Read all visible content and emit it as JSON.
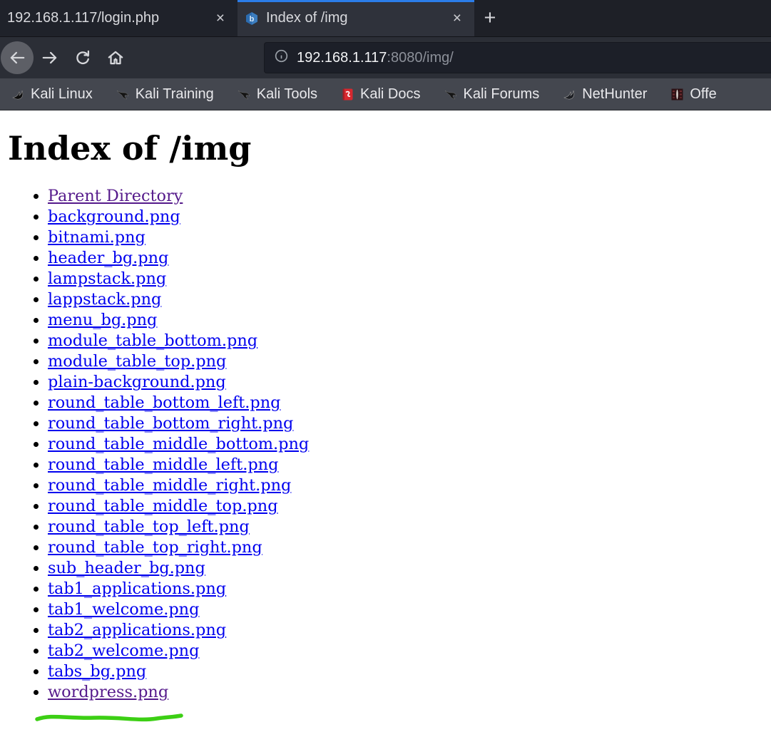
{
  "colors": {
    "link": "#0000EE",
    "visited": "#551A8B",
    "annotation": "#3CCF14",
    "accent": "#2B7DE9"
  },
  "browser": {
    "icons": {
      "close": "×",
      "new_tab": "+"
    },
    "tabs": [
      {
        "title": "192.168.1.117/login.php",
        "active": false
      },
      {
        "title": "Index of /img",
        "active": true,
        "favicon": "bitnami-shield"
      }
    ],
    "urlbar": {
      "host": "192.168.1.117",
      "path": ":8080/img/",
      "info_icon": "site-info"
    },
    "bookmarks": [
      {
        "label": "Kali Linux",
        "icon": "kali-dragon"
      },
      {
        "label": "Kali Training",
        "icon": "kali-bird"
      },
      {
        "label": "Kali Tools",
        "icon": "kali-bird"
      },
      {
        "label": "Kali Docs",
        "icon": "red-book"
      },
      {
        "label": "Kali Forums",
        "icon": "kali-bird"
      },
      {
        "label": "NetHunter",
        "icon": "kali-dragon"
      },
      {
        "label": "Offe",
        "icon": "offsec-badge"
      }
    ]
  },
  "page": {
    "heading": "Index of /img",
    "links": [
      {
        "label": "Parent Directory",
        "visited": true
      },
      {
        "label": "background.png",
        "visited": false
      },
      {
        "label": "bitnami.png",
        "visited": false
      },
      {
        "label": "header_bg.png",
        "visited": false
      },
      {
        "label": "lampstack.png",
        "visited": false
      },
      {
        "label": "lappstack.png",
        "visited": false
      },
      {
        "label": "menu_bg.png",
        "visited": false
      },
      {
        "label": "module_table_bottom.png",
        "visited": false
      },
      {
        "label": "module_table_top.png",
        "visited": false
      },
      {
        "label": "plain-background.png",
        "visited": false
      },
      {
        "label": "round_table_bottom_left.png",
        "visited": false
      },
      {
        "label": "round_table_bottom_right.png",
        "visited": false
      },
      {
        "label": "round_table_middle_bottom.png",
        "visited": false
      },
      {
        "label": "round_table_middle_left.png",
        "visited": false
      },
      {
        "label": "round_table_middle_right.png",
        "visited": false
      },
      {
        "label": "round_table_middle_top.png",
        "visited": false
      },
      {
        "label": "round_table_top_left.png",
        "visited": false
      },
      {
        "label": "round_table_top_right.png",
        "visited": false
      },
      {
        "label": "sub_header_bg.png",
        "visited": false
      },
      {
        "label": "tab1_applications.png",
        "visited": false
      },
      {
        "label": "tab1_welcome.png",
        "visited": false
      },
      {
        "label": "tab2_applications.png",
        "visited": false
      },
      {
        "label": "tab2_welcome.png",
        "visited": false
      },
      {
        "label": "tabs_bg.png",
        "visited": false
      },
      {
        "label": "wordpress.png",
        "visited": true
      }
    ]
  }
}
